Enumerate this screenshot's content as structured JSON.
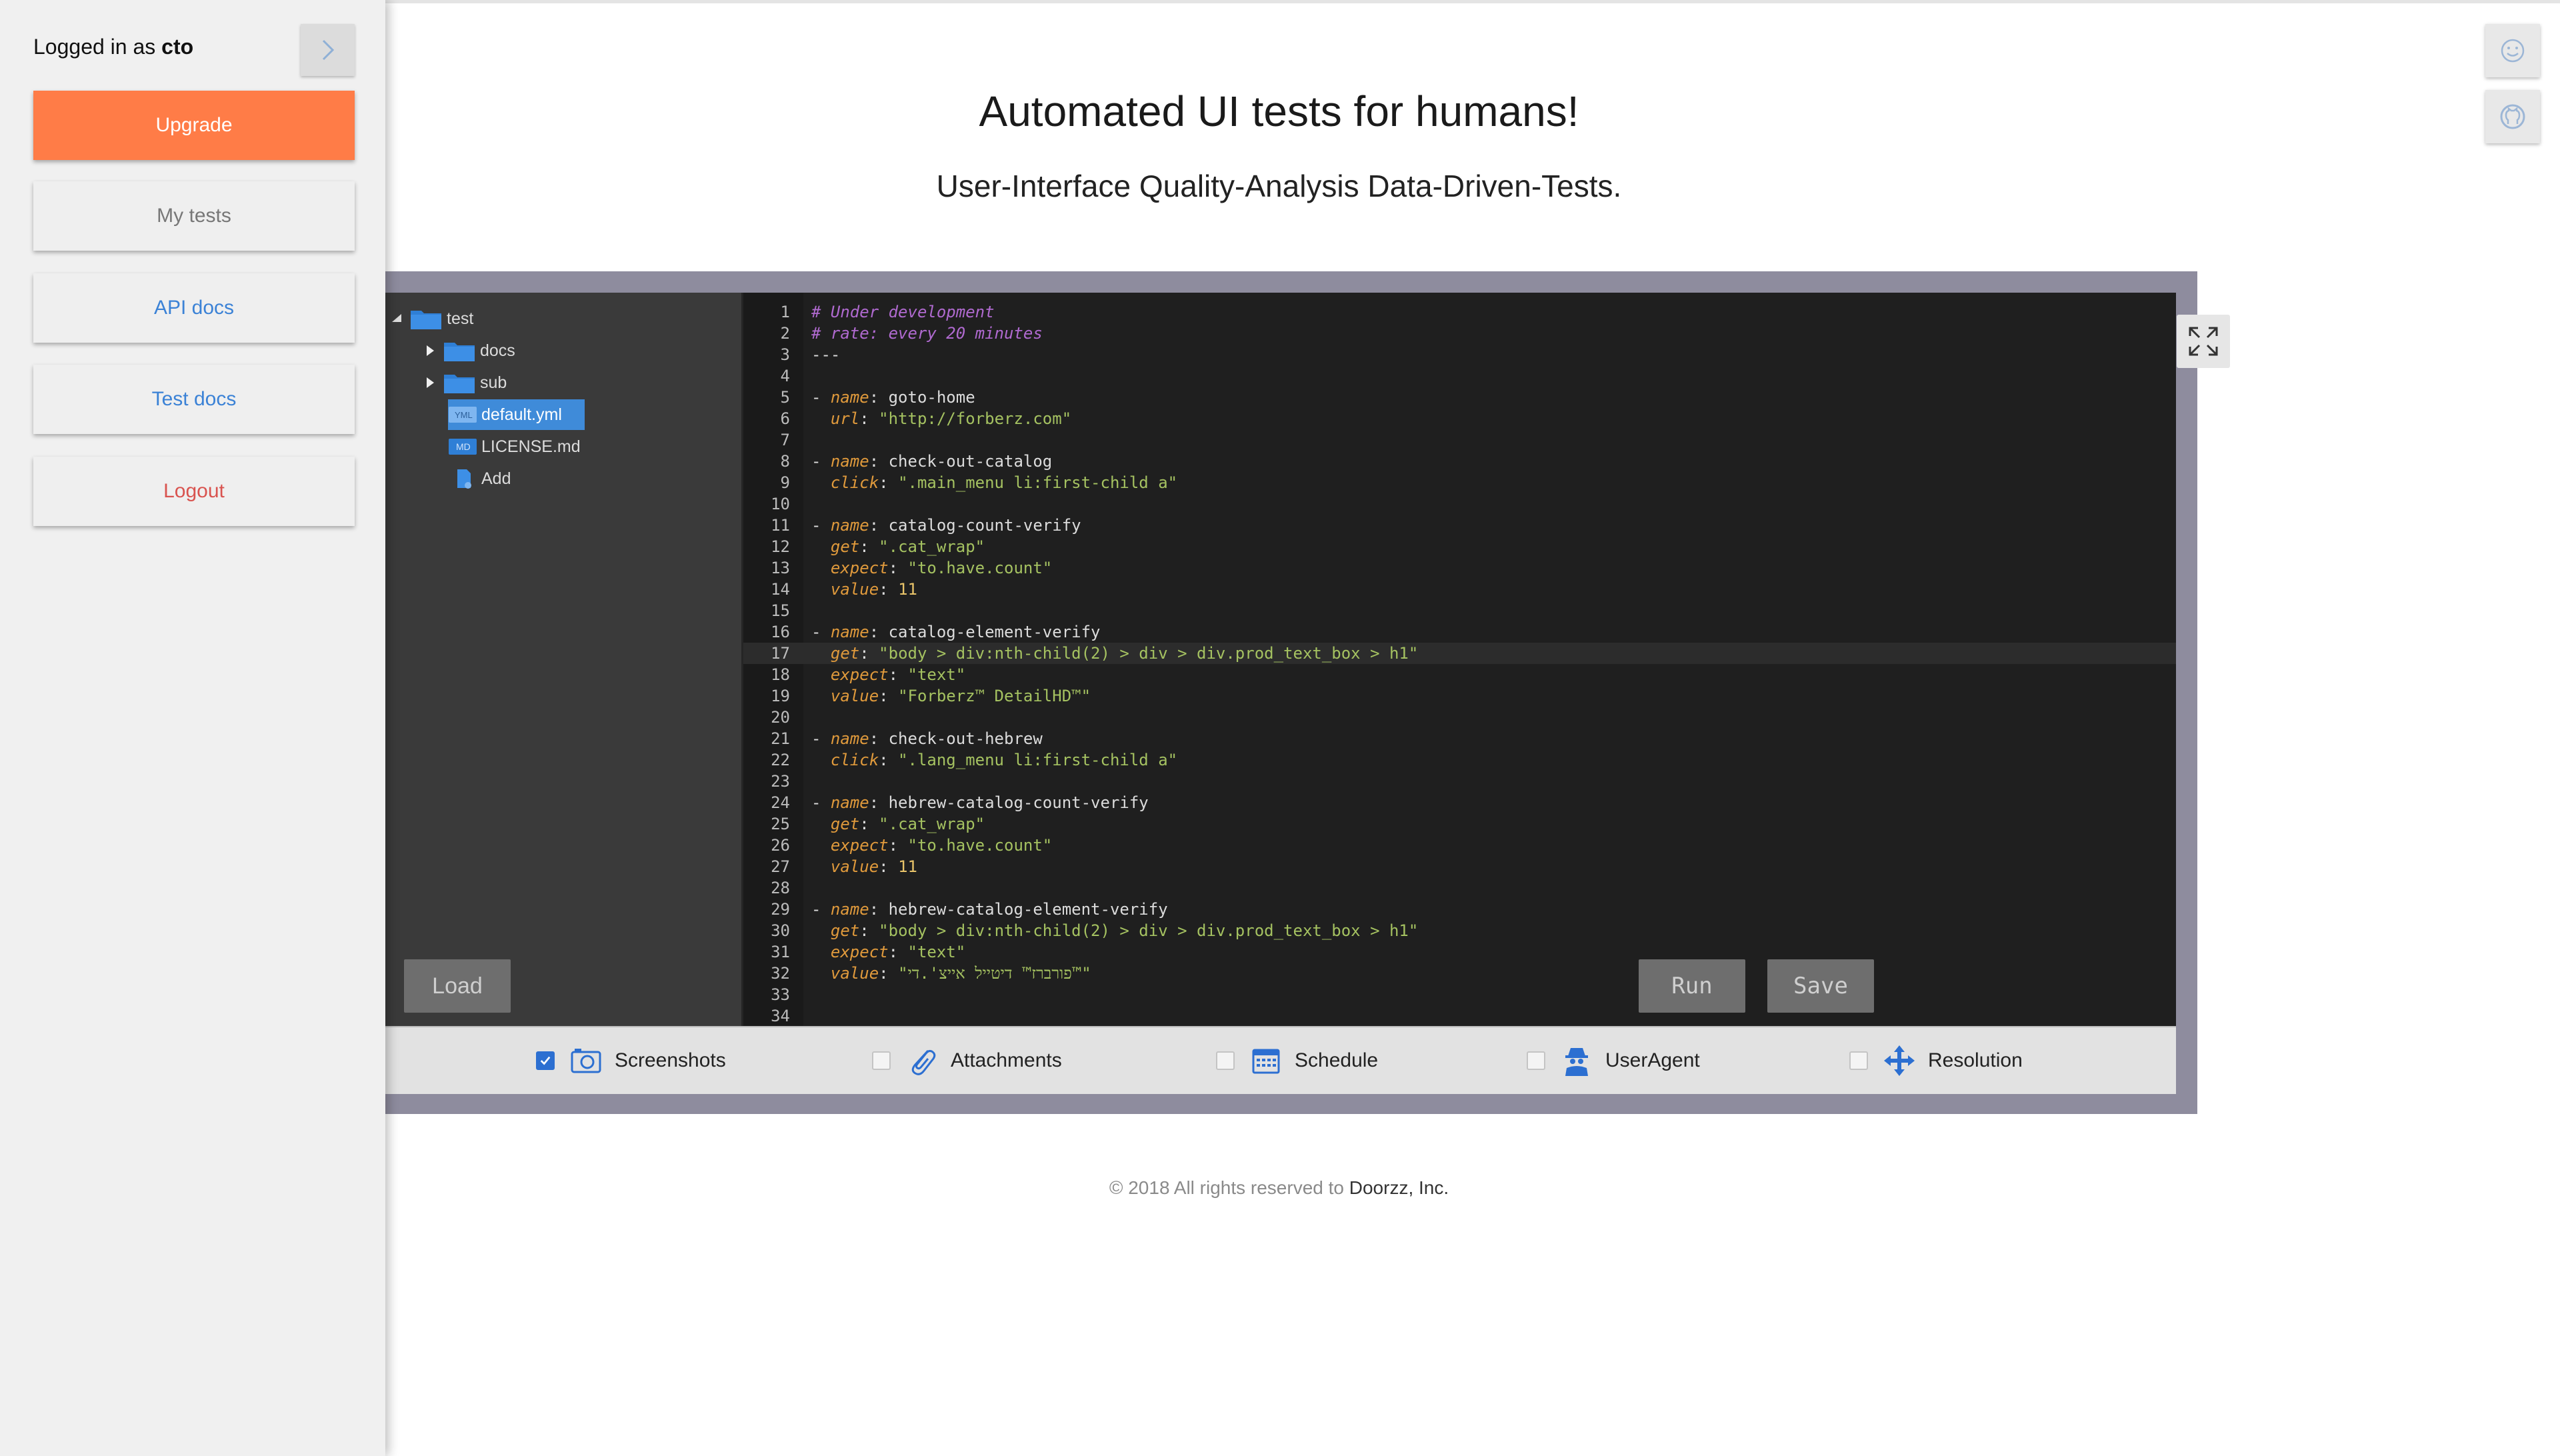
{
  "sidebar": {
    "login_prefix": "Logged in as",
    "username": "cto",
    "buttons": {
      "upgrade": "Upgrade",
      "my_tests": "My tests",
      "api_docs": "API docs",
      "test_docs": "Test docs",
      "logout": "Logout"
    }
  },
  "header": {
    "title": "Automated UI tests for humans!",
    "subtitle": "User-Interface Quality-Analysis Data-Driven-Tests."
  },
  "tree": {
    "root": "test",
    "folders": [
      "docs",
      "sub"
    ],
    "files": [
      {
        "badge": "YML",
        "name": "default.yml"
      },
      {
        "badge": "MD",
        "name": "LICENSE.md"
      }
    ],
    "add_label": "Add"
  },
  "editor": {
    "lines": [
      "# Under development",
      "# rate: every 20 minutes",
      "---",
      "",
      "- name: goto-home",
      "  url: \"http://forberz.com\"",
      "",
      "- name: check-out-catalog",
      "  click: \".main_menu li:first-child a\"",
      "",
      "- name: catalog-count-verify",
      "  get: \".cat_wrap\"",
      "  expect: \"to.have.count\"",
      "  value: 11",
      "",
      "- name: catalog-element-verify",
      "  get: \"body > div:nth-child(2) > div > div.prod_text_box > h1\"",
      "  expect: \"text\"",
      "  value: \"Forberz™ DetailHD™\"",
      "",
      "- name: check-out-hebrew",
      "  click: \".lang_menu li:first-child a\"",
      "",
      "- name: hebrew-catalog-count-verify",
      "  get: \".cat_wrap\"",
      "  expect: \"to.have.count\"",
      "  value: 11",
      "",
      "- name: hebrew-catalog-element-verify",
      "  get: \"body > div:nth-child(2) > div > div.prod_text_box > h1\"",
      "  expect: \"text\"",
      "  value: \"פורברז™ דיטייל אייצ'.די™\"",
      "",
      ""
    ],
    "active_line": 17
  },
  "actions": {
    "load": "Load",
    "run": "Run",
    "save": "Save"
  },
  "options": [
    {
      "label": "Screenshots",
      "checked": true
    },
    {
      "label": "Attachments",
      "checked": false
    },
    {
      "label": "Schedule",
      "checked": false
    },
    {
      "label": "UserAgent",
      "checked": false
    },
    {
      "label": "Resolution",
      "checked": false
    }
  ],
  "footer": {
    "text": "© 2018 All rights reserved to",
    "company": "Doorzz, Inc."
  },
  "colors": {
    "upgrade": "#ff7c47",
    "link_blue": "#3b82d6",
    "logout_red": "#d9534f",
    "frame": "#8e8c9e",
    "selection": "#3f8bd9"
  }
}
